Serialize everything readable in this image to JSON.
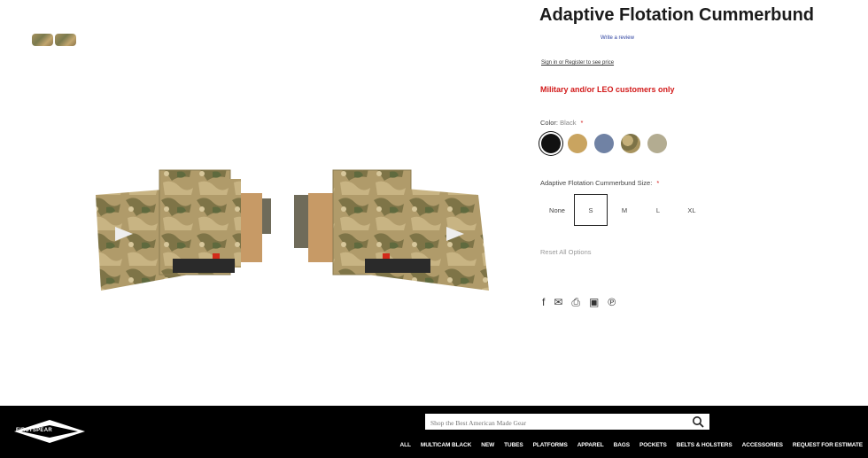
{
  "product": {
    "title": "Adaptive Flotation Cummerbund",
    "review_link": "Write a review",
    "signin_text": "Sign in or Register to see price",
    "notice": "Military and/or LEO customers only"
  },
  "color_option": {
    "label": "Color:",
    "selected": "Black",
    "required_marker": "*",
    "swatches": [
      {
        "name": "Black",
        "color": "#111111"
      },
      {
        "name": "Coyote",
        "color": "#c9a460"
      },
      {
        "name": "Blue",
        "color": "#7082a4"
      },
      {
        "name": "Multicam",
        "color": "#a8945f"
      },
      {
        "name": "Ranger Green",
        "color": "#b3ac91"
      }
    ]
  },
  "size_option": {
    "label": "Adaptive Flotation Cummerbund Size:",
    "required_marker": "*",
    "options": [
      "None",
      "S",
      "M",
      "L",
      "XL"
    ],
    "selected": "S"
  },
  "reset_label": "Reset All Options",
  "share_icons": [
    "facebook-icon",
    "email-icon",
    "print-icon",
    "linkedin-icon",
    "pinterest-icon"
  ],
  "footer": {
    "logo_text": "FIRSTSPEAR",
    "search_placeholder": "Shop the Best American Made Gear",
    "nav_items": [
      "ALL",
      "MULTICAM BLACK",
      "NEW",
      "TUBES",
      "PLATFORMS",
      "APPAREL",
      "BAGS",
      "POCKETS",
      "BELTS & HOLSTERS",
      "ACCESSORIES",
      "REQUEST FOR ESTIMATE"
    ]
  },
  "colors": {
    "notice_red": "#d21a1a",
    "footer_bg": "#000000",
    "link_blue": "#2a3f9f"
  }
}
